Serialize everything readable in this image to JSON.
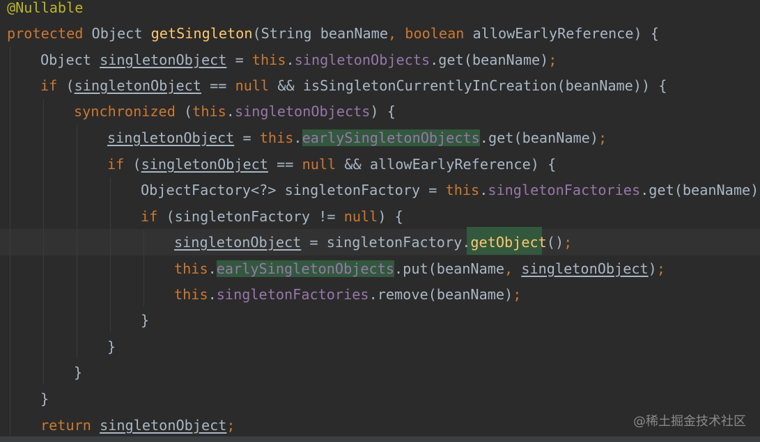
{
  "code": {
    "annotation": "@Nullable",
    "kw_protected": "protected",
    "type_object": "Object",
    "method_name": "getSingleton",
    "type_string": "String",
    "param_beanName": "beanName",
    "kw_boolean": "boolean",
    "param_allowEarly": "allowEarlyReference",
    "var_singletonObject": "singletonObject",
    "kw_this": "this",
    "field_singletonObjects": "singletonObjects",
    "method_get": "get",
    "kw_if": "if",
    "kw_null": "null",
    "method_isCreating": "isSingletonCurrentlyInCreation",
    "kw_synchronized": "synchronized",
    "field_earlySingletonObjects": "earlySingletonObjects",
    "type_objectFactory": "ObjectFactory<?>",
    "var_singletonFactory": "singletonFactory",
    "field_singletonFactories": "singletonFactories",
    "method_getObject": "getObject",
    "method_put": "put",
    "method_remove": "remove",
    "kw_return": "return",
    "op_assign": "=",
    "op_eq": "==",
    "op_neq": "!=",
    "op_and": "&&",
    "open_brace": "{",
    "close_brace": "}",
    "semicolon": ";",
    "comma": ",",
    "dot": ".",
    "lparen": "(",
    "rparen": ")",
    "parens_empty": "()"
  },
  "watermark": "@稀土掘金技术社区",
  "colors": {
    "background": "#2b2b2b",
    "keyword": "#cc7832",
    "annotation": "#bbb529",
    "field": "#9876aa",
    "method_decl": "#ffc66d",
    "text": "#a9b7c6",
    "highlight": "#32593d"
  }
}
